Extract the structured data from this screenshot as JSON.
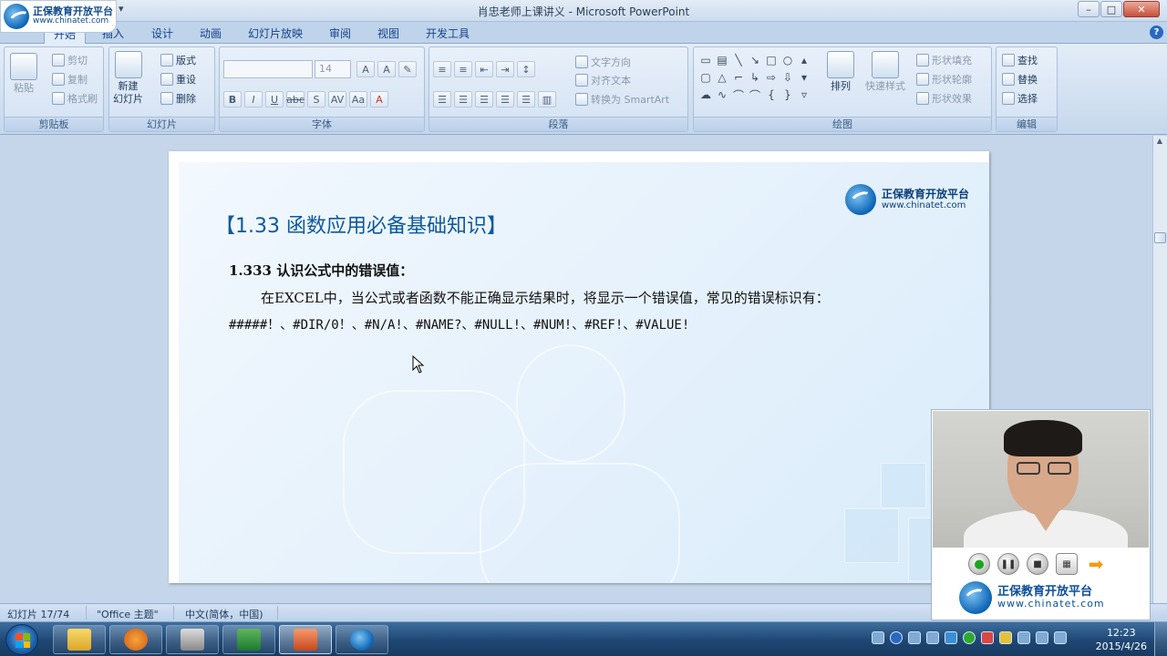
{
  "window": {
    "title": "肖忠老师上课讲义 - Microsoft PowerPoint",
    "min_label": "–",
    "max_label": "□",
    "close_label": "✕"
  },
  "brand": {
    "name_cn": "正保教育开放平台",
    "url": "www.chinatet.com"
  },
  "ribbon_tabs": [
    {
      "label": "开始",
      "active": true
    },
    {
      "label": "插入"
    },
    {
      "label": "设计"
    },
    {
      "label": "动画"
    },
    {
      "label": "幻灯片放映"
    },
    {
      "label": "审阅"
    },
    {
      "label": "视图"
    },
    {
      "label": "开发工具"
    }
  ],
  "ribbon": {
    "clipboard": {
      "label": "剪贴板",
      "paste": "粘贴",
      "cut": "剪切",
      "copy": "复制",
      "format_painter": "格式刷"
    },
    "slides": {
      "label": "幻灯片",
      "new_slide_1": "新建",
      "new_slide_2": "幻灯片",
      "layout": "版式",
      "reset": "重设",
      "delete": "删除"
    },
    "font": {
      "label": "字体",
      "font_name": "",
      "font_size": "14"
    },
    "paragraph": {
      "label": "段落",
      "text_direction": "文字方向",
      "align_text": "对齐文本",
      "smartart": "转换为 SmartArt"
    },
    "drawing": {
      "label": "绘图",
      "arrange": "排列",
      "quick_styles": "快速样式",
      "shape_fill": "形状填充",
      "shape_outline": "形状轮廓",
      "shape_effects": "形状效果"
    },
    "editing": {
      "label": "编辑",
      "find": "查找",
      "replace": "替换",
      "select": "选择"
    }
  },
  "slide": {
    "title": "【1.33 函数应用必备基础知识】",
    "subtitle": "1.333 认识公式中的错误值：",
    "paragraph": "在EXCEL中，当公式或者函数不能正确显示结果时，将显示一个错误值，常见的错误标识有：",
    "errors": "#####！、#DIR/0！、#N/A!、#NAME?、#NULL!、#NUM!、#REF!、#VALUE!"
  },
  "status": {
    "slide_counter": "幻灯片 17/74",
    "theme": "\"Office 主题\"",
    "language": "中文(简体，中国)"
  },
  "taskbar": {
    "time": "12:23",
    "date": "2015/4/26"
  },
  "colors": {
    "title_blue": "#0e5a9c",
    "ribbon_bg": "#d0def0",
    "taskbar_bg": "#1f4773"
  }
}
